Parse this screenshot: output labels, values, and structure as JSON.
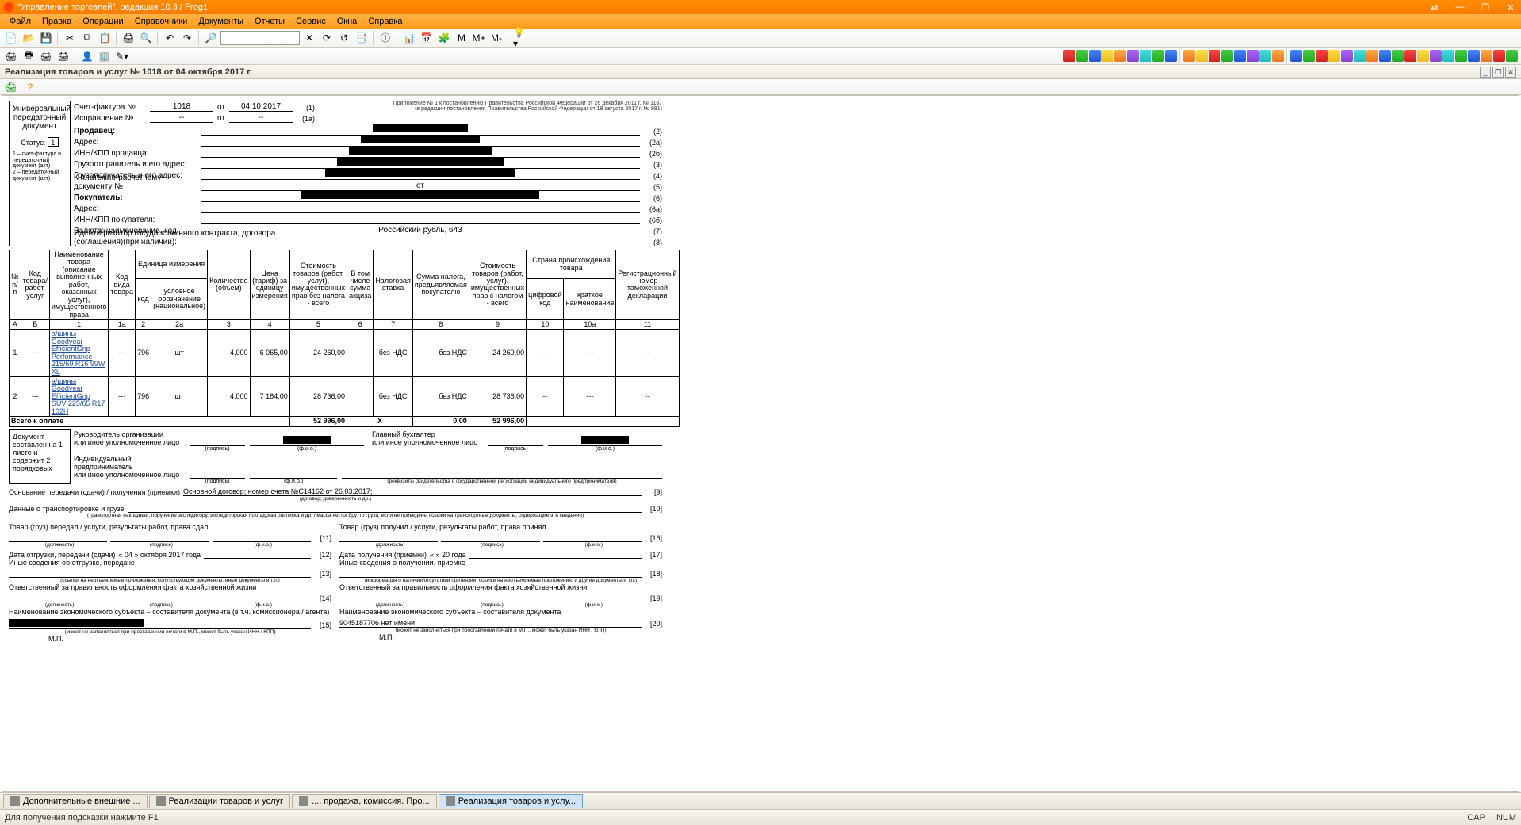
{
  "window": {
    "title": "\"Управление торговлей\", редакция 10.3 / Prog1"
  },
  "menu": [
    "Файл",
    "Правка",
    "Операции",
    "Справочники",
    "Документы",
    "Отчеты",
    "Сервис",
    "Окна",
    "Справка"
  ],
  "doc_header": "Реализация товаров и услуг № 1018 от 04 октября 2017 г.",
  "upd": {
    "title": "Универсальный передаточный документ",
    "status_label": "Статус:",
    "status_value": "1",
    "legend": "1 – счет-фактура и передаточный документ (акт)\n2 – передаточный документ (акт)",
    "regnote1": "Приложение № 1 к постановлению Правительства Российской Федерации от 26 декабря 2011 г. № 1137",
    "regnote2": "(в редакции постановления Правительства Российской Федерации от 19 августа 2017 г. № 981)",
    "sf_label": "Счет-фактура №",
    "sf_num": "1018",
    "sf_ot": "от",
    "sf_date": "04.10.2017",
    "sf_code": "(1)",
    "isp_label": "Исправление №",
    "isp_num": "--",
    "isp_date": "--",
    "isp_code": "(1а)",
    "rows": [
      {
        "lbl": "Продавец:",
        "val": "",
        "code": "(2)",
        "bold": true
      },
      {
        "lbl": "Адрес:",
        "val": "",
        "code": "(2а)"
      },
      {
        "lbl": "ИНН/КПП продавца:",
        "val": "",
        "code": "(2б)"
      },
      {
        "lbl": "Грузоотправитель и его адрес:",
        "val": "",
        "code": "(3)"
      },
      {
        "lbl": "Грузополучатель и его адрес:",
        "val": "",
        "code": "(4)"
      },
      {
        "lbl": "К платежно-расчетному документу №",
        "val": "от",
        "code": "(5)"
      },
      {
        "lbl": "Покупатель:",
        "val": "",
        "code": "(6)",
        "bold": true
      },
      {
        "lbl": "Адрес:",
        "val": "",
        "code": "(6а)"
      },
      {
        "lbl": "ИНН/КПП покупателя:",
        "val": "",
        "code": "(6б)"
      },
      {
        "lbl": "Валюта: наименование, код",
        "val": "Российский рубль, 643",
        "code": "(7)"
      },
      {
        "lbl": "Идентификатор государственного контракта, договора (соглашения)(при наличии):",
        "val": "",
        "code": "(8)"
      }
    ]
  },
  "table": {
    "headers": {
      "c1": "№ п/п",
      "c2": "Код товара/ работ, услуг",
      "c3": "Наименование товара (описание выполненных работ, оказанных услуг), имущественного права",
      "c4": "Код вида товара",
      "c5": "Единица измерения",
      "c5a": "код",
      "c5b": "условное обозначение (национальное)",
      "c6": "Количество (объем)",
      "c7": "Цена (тариф) за единицу измерения",
      "c8": "Стоимость товаров (работ, услуг), имущественных прав без налога - всего",
      "c9": "В том числе сумма акциза",
      "c10": "Налоговая ставка",
      "c11": "Сумма налога, предъявляемая покупателю",
      "c12": "Стоимость товаров (работ, услуг), имущественных прав с налогом - всего",
      "c13": "Страна происхождения товара",
      "c13a": "цифровой код",
      "c13b": "краткое наименование",
      "c14": "Регистрационный номер таможенной декларации"
    },
    "colnums": [
      "А",
      "Б",
      "1",
      "1а",
      "2",
      "2а",
      "3",
      "4",
      "5",
      "6",
      "7",
      "8",
      "9",
      "10",
      "10а",
      "11"
    ],
    "rows": [
      {
        "n": "1",
        "code": "---",
        "name": "а/шины Goodyear EfficientGrip Performance 215/60 R16 99W XL",
        "kind": "---",
        "ucode": "796",
        "uname": "шт",
        "qty": "4,000",
        "price": "6 065,00",
        "sum_no_tax": "24 260,00",
        "excise": "",
        "rate": "без НДС",
        "tax": "без НДС",
        "sum_tax": "24 260,00",
        "ccode": "--",
        "cname": "---",
        "decl": "--"
      },
      {
        "n": "2",
        "code": "---",
        "name": "а/шины Goodyear EfficientGrip SUV 225/65 R17 102H",
        "kind": "---",
        "ucode": "796",
        "uname": "шт",
        "qty": "4,000",
        "price": "7 184,00",
        "sum_no_tax": "28 736,00",
        "excise": "",
        "rate": "без НДС",
        "tax": "без НДС",
        "sum_tax": "28 736,00",
        "ccode": "--",
        "cname": "---",
        "decl": "--"
      }
    ],
    "total_label": "Всего к оплате",
    "total_no_tax": "52 996,00",
    "total_x": "Х",
    "total_tax": "0,00",
    "total_with_tax": "52 996,00"
  },
  "sign": {
    "doc_info": "Документ составлен на 1 листе и содержит 2 порядковых",
    "head_label": "Руководитель организации\nили иное уполномоченное лицо",
    "acc_label": "Главный бухгалтер\nили иное уполномоченное лицо",
    "ip_label": "Индивидуальный предприниматель\nили иное уполномоченное лицо",
    "ip_note": "(реквизиты свидетельства о государственной регистрации индивидуального предпринимателя)",
    "sub_sign": "(подпись)",
    "sub_fio": "(ф.и.о.)"
  },
  "lower": {
    "basis_label": "Основание передачи (сдачи) / получения (приемки)",
    "basis_val": "Основной договор; номер счета №С14162       от 26.03.2017;",
    "basis_code": "[9]",
    "basis_note": "(договор; доверенность и др.)",
    "transport_label": "Данные о транспортировке и грузе",
    "transport_code": "[10]",
    "transport_note": "(транспортная накладная, поручение экспедитору, экспедиторская / складская расписка и др. / масса нетто/ брутто груза, если не приведены ссылки на транспортные документы, содержащие эти сведения)",
    "left": {
      "t1": "Товар (груз) передал / услуги, результаты работ, права сдал",
      "c1": "[11]",
      "t2_lbl": "Дата отгрузки, передачи (сдачи)",
      "t2_val": "« 04 »    октября   2017  года",
      "c2": "[12]",
      "t3": "Иные сведения об отгрузке, передаче",
      "c3": "[13]",
      "t3_note": "(ссылки на неотъемлемые приложения, сопутствующие документы, иные документы и т.п.)",
      "t4": "Ответственный за правильность оформления факта хозяйственной жизни",
      "c4": "[14]",
      "t5": "Наименование экономического субъекта – составителя документа (в т.ч. комиссионера / агента)",
      "c5": "[15]",
      "t5_note": "(может не заполняться при проставлении печати в М.П., может быть указан ИНН / КПП)",
      "mp": "М.П."
    },
    "right": {
      "t1": "Товар (груз) получил / услуги, результаты работ, права принял",
      "c1": "[16]",
      "t2_lbl": "Дата получения (приемки)",
      "t2_val": "«      »                 20      года",
      "c2": "[17]",
      "t3": "Иные сведения о получении, приемке",
      "c3": "[18]",
      "t3_note": "(информация о наличии/отсутствии претензии; ссылки на неотъемлемые приложения, и другие документы и т.п.)",
      "t4": "Ответственный за правильность оформления факта хозяйственной жизни",
      "c4": "[19]",
      "t5": "Наименование экономического субъекта – составителя документа",
      "t5_val": "9045187706 нет имени",
      "c5": "[20]",
      "t5_note": "(может не заполняться при проставлении печати в М.П., может быть указан ИНН / КПП)",
      "mp": "М.П."
    },
    "sub_pos": "(должность)",
    "sub_sign": "(подпись)",
    "sub_fio": "(ф.и.о.)"
  },
  "tabs": [
    {
      "label": "Дополнительные внешние ...",
      "active": false
    },
    {
      "label": "Реализации товаров и услуг",
      "active": false
    },
    {
      "label": "..., продажа, комиссия. Про...",
      "active": false
    },
    {
      "label": "Реализация товаров и услу...",
      "active": true
    }
  ],
  "statusbar": {
    "hint": "Для получения подсказки нажмите F1",
    "cap": "CAP",
    "num": "NUM"
  }
}
